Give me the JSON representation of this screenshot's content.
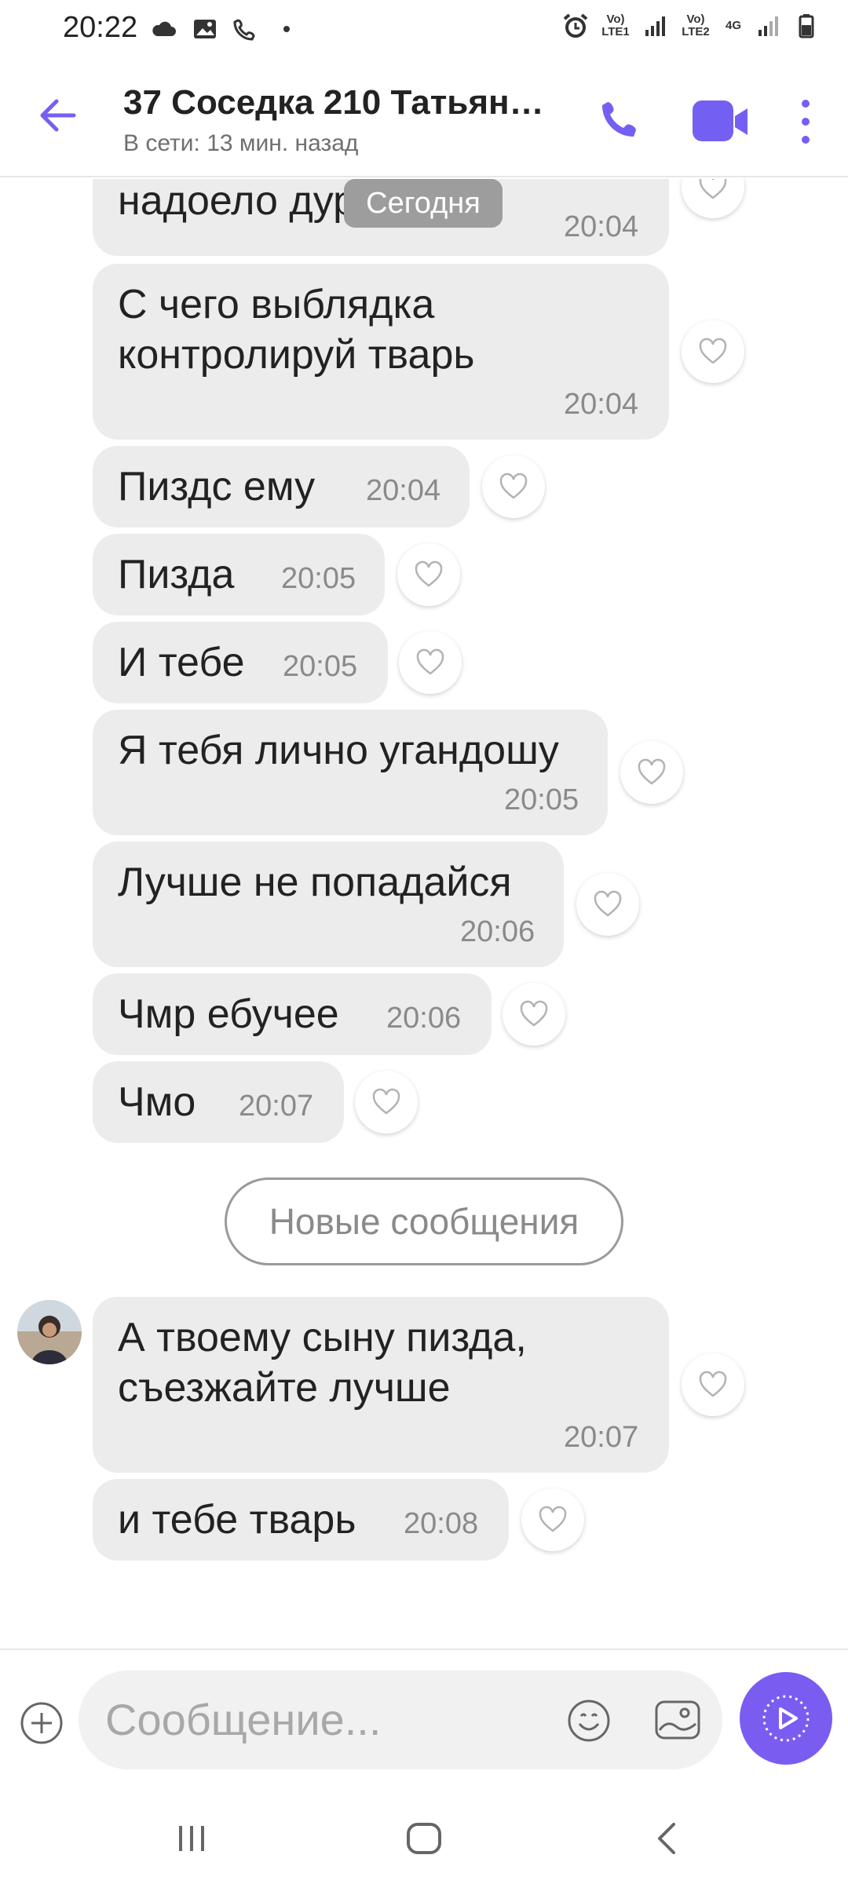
{
  "status_bar": {
    "time": "20:22",
    "left_icons": [
      "cloud-icon",
      "image-icon",
      "wifi-call-icon",
      "dot-icon"
    ],
    "right_icons": [
      "alarm-icon",
      "volte-lte1-icon",
      "signal-icon",
      "volte-lte2-icon",
      "4g-icon",
      "signal-icon",
      "battery-icon"
    ],
    "sim1": "Vo) LTE1",
    "sim2": "Vo) LTE2",
    "net": "4G"
  },
  "header": {
    "title": "37 Соседка 210 Татьян…",
    "status": "В сети: 13 мин. назад",
    "accent": "#7360f2"
  },
  "chat": {
    "date_label": "Сегодня",
    "messages": [
      {
        "text": "надоело дура",
        "time": "20:04"
      },
      {
        "text": "С чего выблядка\nконтролируй тварь",
        "time": "20:04"
      },
      {
        "text": "Пиздс ему",
        "time": "20:04"
      },
      {
        "text": "Пизда",
        "time": "20:05"
      },
      {
        "text": "И тебе",
        "time": "20:05"
      },
      {
        "text": "Я тебя лично угандошу",
        "time": "20:05"
      },
      {
        "text": "Лучше не попадайся",
        "time": "20:06"
      },
      {
        "text": "Чмр ебучее",
        "time": "20:06"
      },
      {
        "text": "Чмо",
        "time": "20:07"
      },
      {
        "text": "А твоему сыну пизда,\nсъезжайте лучше",
        "time": "20:07"
      },
      {
        "text": "и тебе тварь",
        "time": "20:08"
      }
    ],
    "new_messages_label": "Новые сообщения"
  },
  "composer": {
    "placeholder": "Сообщение...",
    "send_color": "#7b5cf0"
  }
}
